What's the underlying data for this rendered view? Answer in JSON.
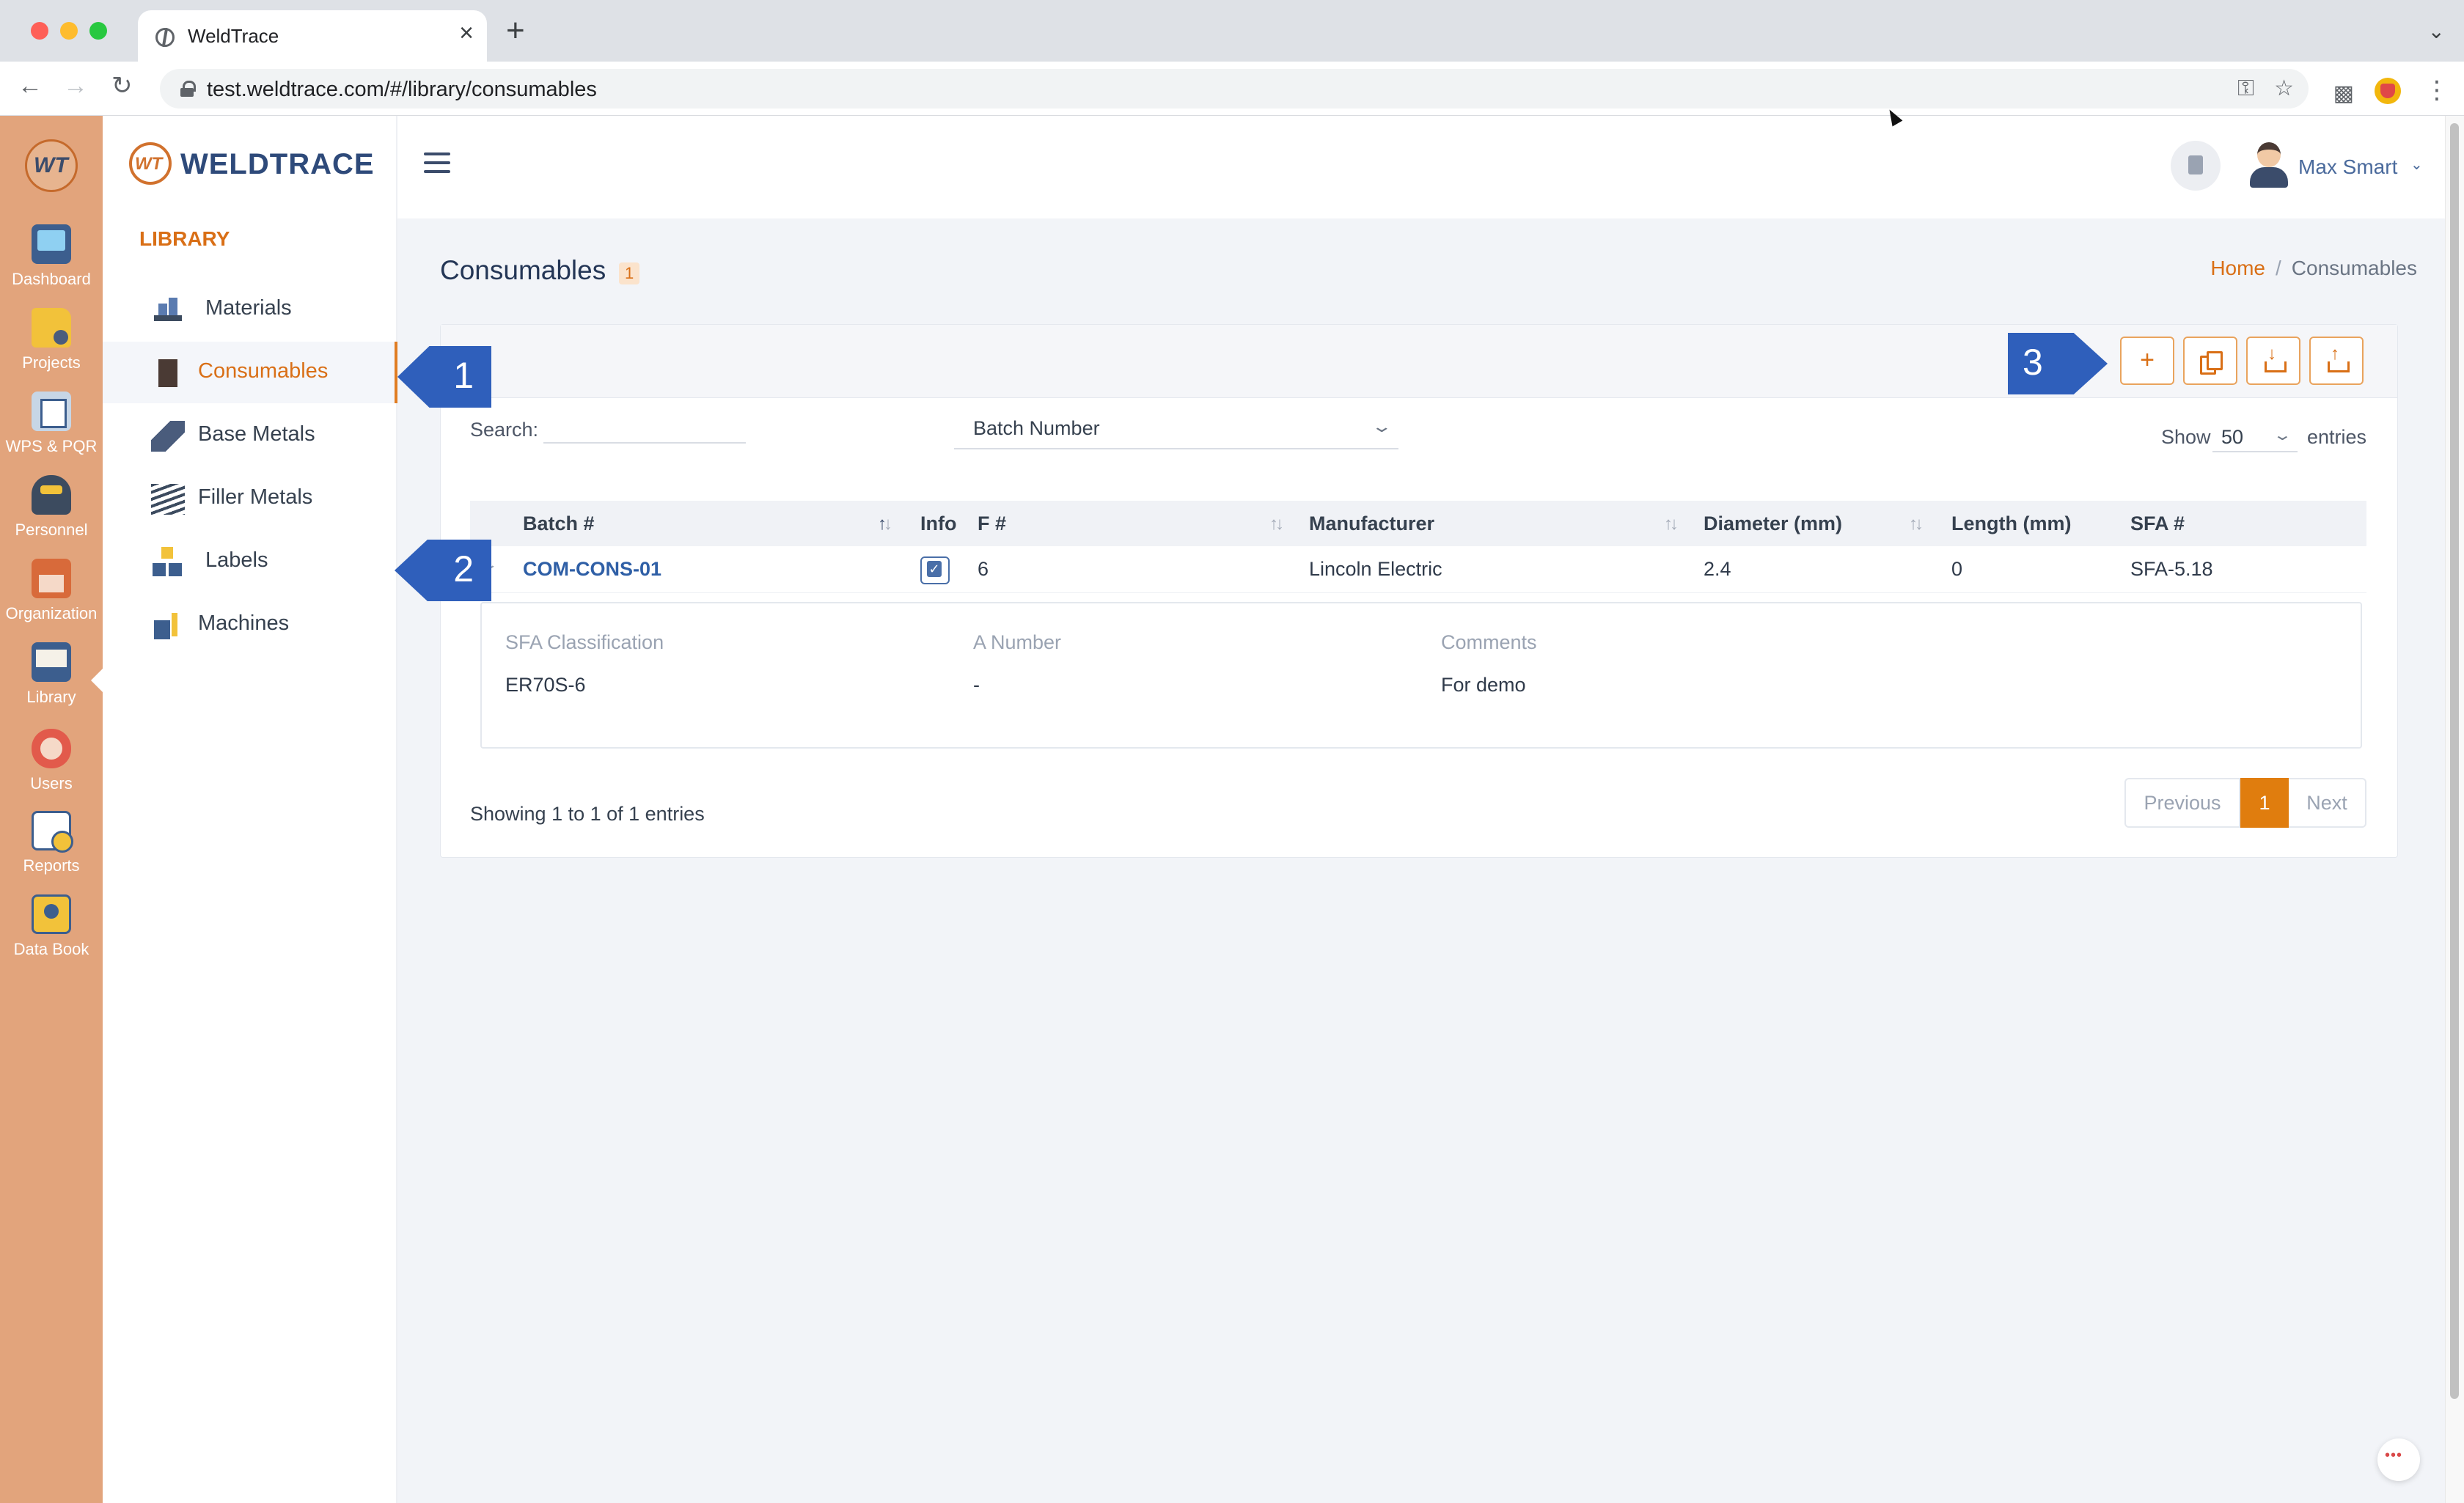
{
  "browser": {
    "tab_title": "WeldTrace",
    "url": "test.weldtrace.com/#/library/consumables",
    "new_tab_glyph": "+",
    "close_glyph": "×"
  },
  "rail": {
    "logo_text": "WT",
    "items": [
      {
        "label": "Dashboard",
        "icon": "dashboard-icon"
      },
      {
        "label": "Projects",
        "icon": "projects-icon"
      },
      {
        "label": "WPS & PQR",
        "icon": "wps-pqr-icon"
      },
      {
        "label": "Personnel",
        "icon": "personnel-icon"
      },
      {
        "label": "Organization",
        "icon": "organization-icon"
      },
      {
        "label": "Library",
        "icon": "library-icon",
        "active": true
      },
      {
        "label": "Users",
        "icon": "users-icon"
      },
      {
        "label": "Reports",
        "icon": "reports-icon"
      },
      {
        "label": "Data Book",
        "icon": "data-book-icon"
      }
    ]
  },
  "brand": {
    "mark": "WT",
    "name": "WELDTRACE"
  },
  "subnav": {
    "heading": "LIBRARY",
    "items": [
      {
        "label": "Materials",
        "icon": "materials-icon"
      },
      {
        "label": "Consumables",
        "icon": "consumables-icon",
        "active": true
      },
      {
        "label": "Base Metals",
        "icon": "base-metals-icon"
      },
      {
        "label": "Filler Metals",
        "icon": "filler-metals-icon"
      },
      {
        "label": "Labels",
        "icon": "labels-icon"
      },
      {
        "label": "Machines",
        "icon": "machines-icon"
      }
    ]
  },
  "header": {
    "user_name": "Max Smart"
  },
  "page": {
    "title": "Consumables",
    "count": "1",
    "breadcrumb": {
      "home": "Home",
      "separator": "/",
      "current": "Consumables"
    }
  },
  "toolbar": {
    "add_glyph": "+",
    "buttons": [
      "add-icon",
      "copy-icon",
      "download-icon",
      "upload-icon"
    ]
  },
  "filters": {
    "search_label": "Search:",
    "search_value": "",
    "search_field": "Batch Number",
    "show_label": "Show",
    "page_size": "50",
    "entries_label": "entries"
  },
  "table": {
    "columns": [
      "Batch #",
      "Info",
      "F #",
      "Manufacturer",
      "Diameter (mm)",
      "Length (mm)",
      "SFA #"
    ],
    "rows": [
      {
        "batch": "COM-CONS-01",
        "info_checked": true,
        "f_number": "6",
        "manufacturer": "Lincoln Electric",
        "diameter": "2.4",
        "length": "0",
        "sfa": "SFA-5.18",
        "details": {
          "labels": [
            "SFA Classification",
            "A Number",
            "Comments"
          ],
          "values": [
            "ER70S-6",
            "-",
            "For demo"
          ]
        }
      }
    ]
  },
  "footer": {
    "summary": "Showing 1 to 1 of 1 entries",
    "prev": "Previous",
    "current_page": "1",
    "next": "Next"
  },
  "callouts": [
    "1",
    "2",
    "3"
  ],
  "colors": {
    "accent": "#d96f16",
    "rail_bg": "#e2a47c",
    "link": "#2f5fa6",
    "callout": "#2f5fbb"
  }
}
